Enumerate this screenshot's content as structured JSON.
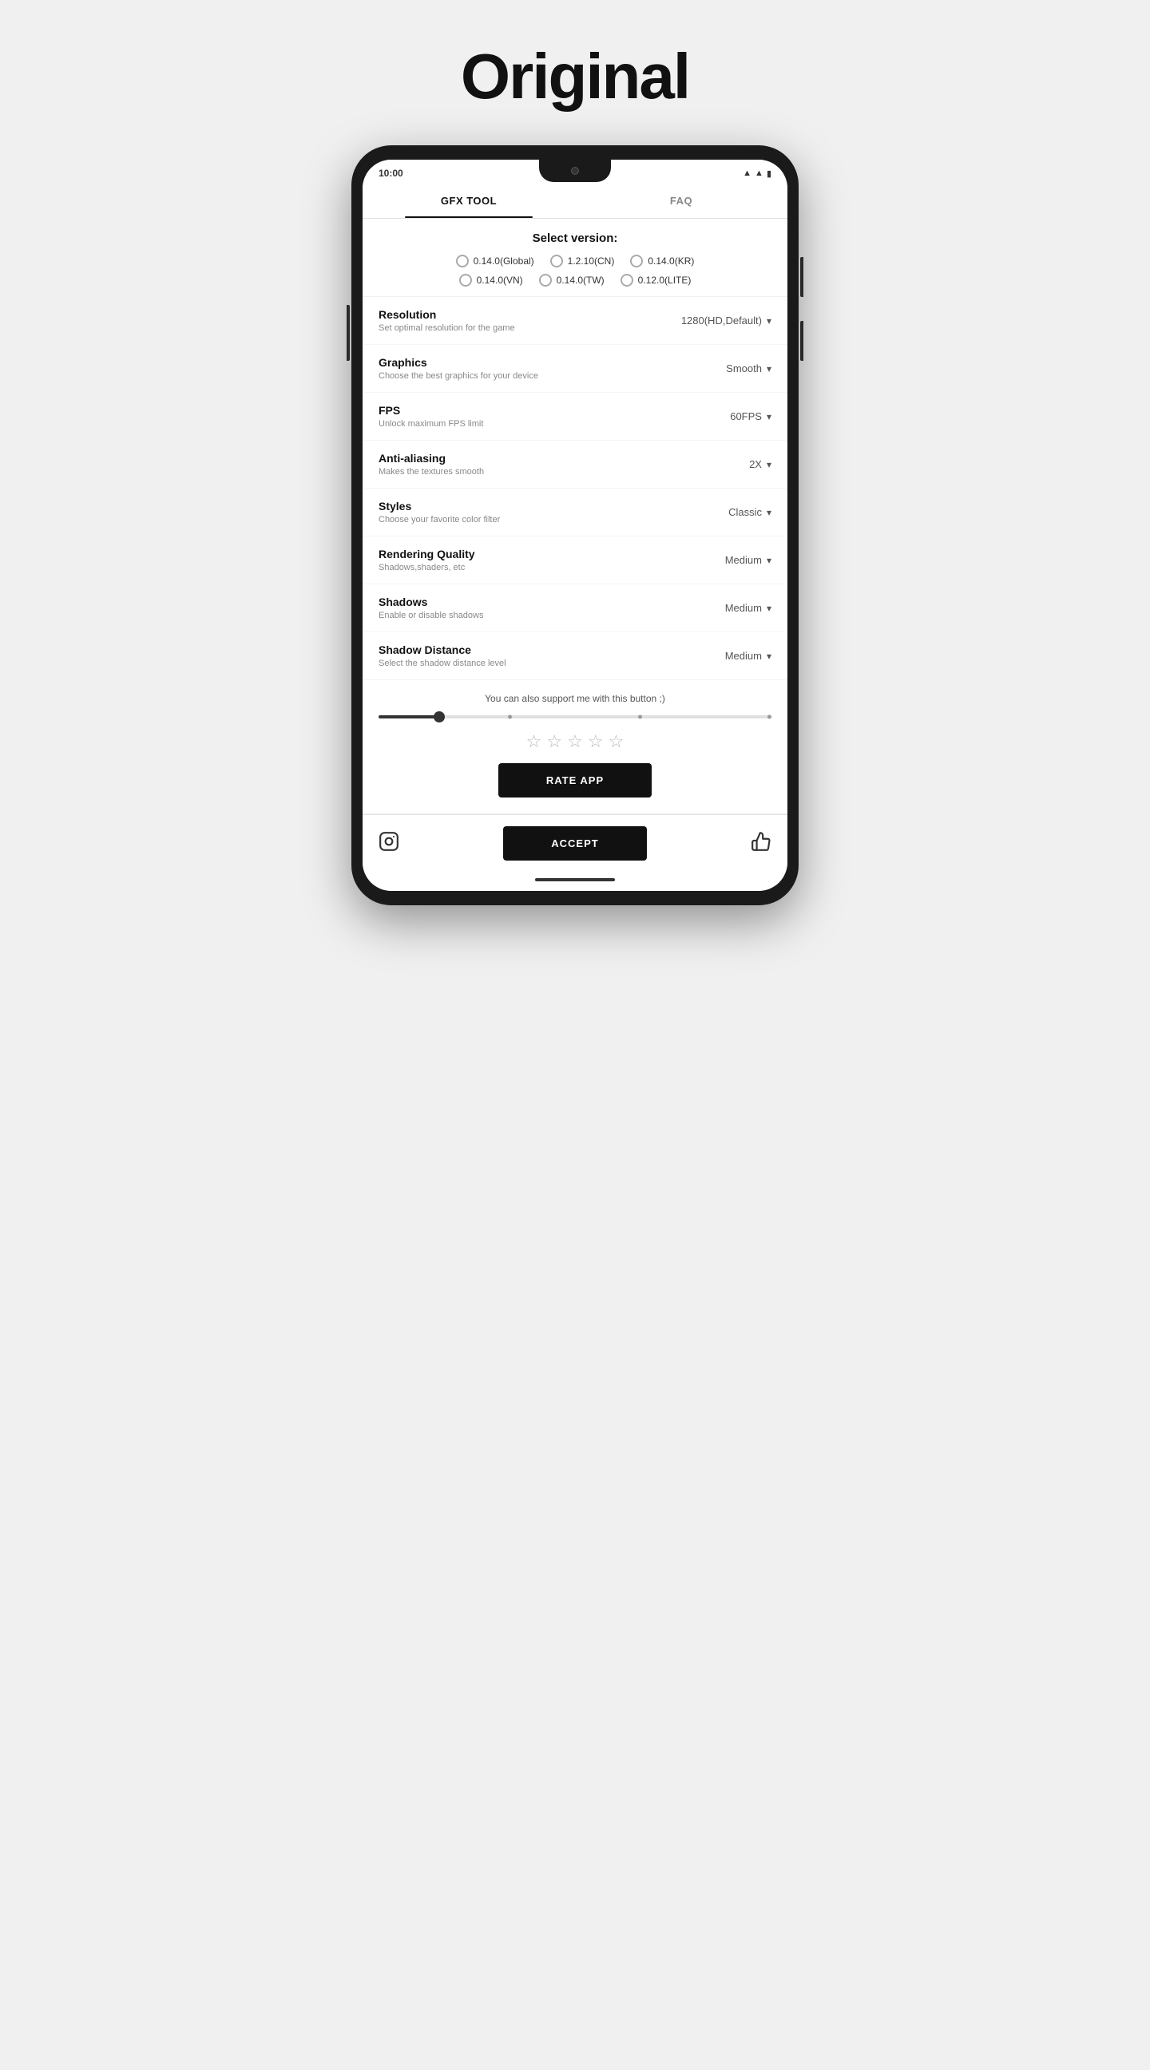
{
  "page": {
    "title": "Original"
  },
  "status_bar": {
    "time": "10:00"
  },
  "tabs": [
    {
      "id": "gfx",
      "label": "GFX TOOL",
      "active": true
    },
    {
      "id": "faq",
      "label": "FAQ",
      "active": false
    }
  ],
  "version_section": {
    "title": "Select version:",
    "options": [
      {
        "id": "global",
        "label": "0.14.0(Global)"
      },
      {
        "id": "cn",
        "label": "1.2.10(CN)"
      },
      {
        "id": "kr",
        "label": "0.14.0(KR)"
      },
      {
        "id": "vn",
        "label": "0.14.0(VN)"
      },
      {
        "id": "tw",
        "label": "0.14.0(TW)"
      },
      {
        "id": "lite",
        "label": "0.12.0(LITE)"
      }
    ]
  },
  "settings": [
    {
      "id": "resolution",
      "label": "Resolution",
      "desc": "Set optimal resolution for the game",
      "value": "1280(HD,Default)"
    },
    {
      "id": "graphics",
      "label": "Graphics",
      "desc": "Choose the best graphics for your device",
      "value": "Smooth"
    },
    {
      "id": "fps",
      "label": "FPS",
      "desc": "Unlock maximum FPS limit",
      "value": "60FPS"
    },
    {
      "id": "anti-aliasing",
      "label": "Anti-aliasing",
      "desc": "Makes the textures smooth",
      "value": "2X"
    },
    {
      "id": "styles",
      "label": "Styles",
      "desc": "Choose your favorite color filter",
      "value": "Classic"
    },
    {
      "id": "rendering-quality",
      "label": "Rendering Quality",
      "desc": "Shadows,shaders, etc",
      "value": "Medium"
    },
    {
      "id": "shadows",
      "label": "Shadows",
      "desc": "Enable or disable shadows",
      "value": "Medium"
    },
    {
      "id": "shadow-distance",
      "label": "Shadow Distance",
      "desc": "Select the shadow distance level",
      "value": "Medium"
    }
  ],
  "support": {
    "text": "You can also support me with this button ;)"
  },
  "rate_section": {
    "stars_count": 5,
    "button_label": "RATE APP"
  },
  "bottom_bar": {
    "accept_label": "ACCEPT"
  }
}
